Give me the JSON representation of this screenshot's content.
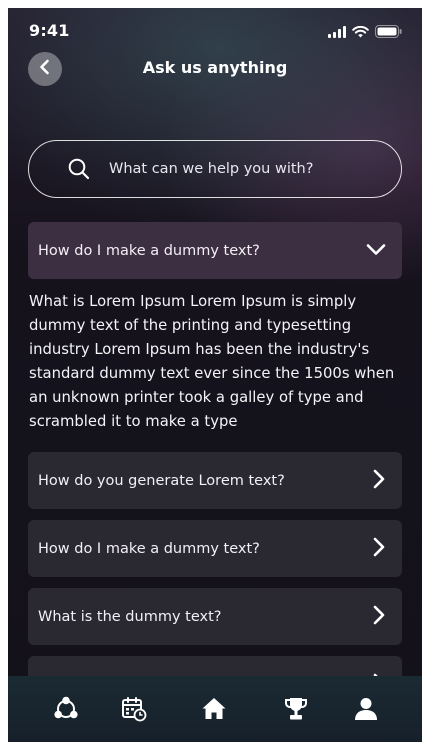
{
  "status_bar": {
    "time": "9:41"
  },
  "header": {
    "title": "Ask us anything"
  },
  "search": {
    "placeholder": "What can we help you with?"
  },
  "faq": {
    "open_item": {
      "question": "How do I make a dummy text?",
      "answer": "What is Lorem Ipsum Lorem Ipsum is simply dummy text of the printing and typesetting industry Lorem Ipsum has been the industry's standard dummy text ever since the 1500s when an unknown printer took a galley of type and scrambled it to make a type"
    },
    "items": [
      {
        "question": "How do you generate Lorem text?"
      },
      {
        "question": "How do I make a dummy text?"
      },
      {
        "question": "What is the dummy text?"
      },
      {
        "question": ""
      }
    ]
  },
  "bottom_nav": {
    "items": [
      {
        "icon": "community-icon"
      },
      {
        "icon": "calendar-icon"
      },
      {
        "icon": "home-icon"
      },
      {
        "icon": "trophy-icon"
      },
      {
        "icon": "profile-icon"
      }
    ]
  },
  "colors": {
    "open_item_bg": "#3d2f42",
    "item_bg": "#2a2830",
    "nav_bg": "#1a2a33"
  }
}
